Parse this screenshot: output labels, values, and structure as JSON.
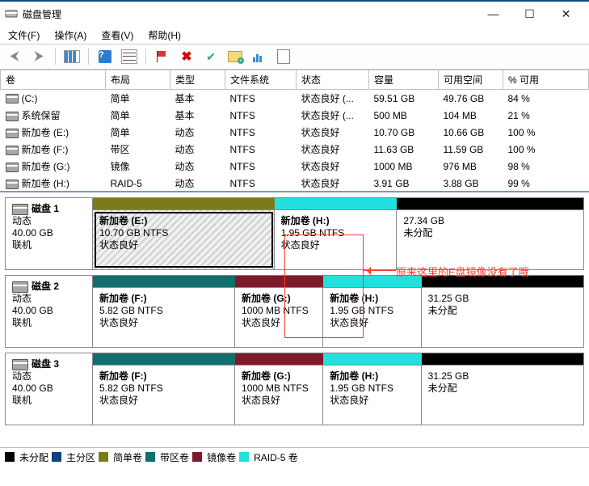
{
  "window": {
    "title": "磁盘管理",
    "min": "—",
    "max": "☐",
    "close": "✕"
  },
  "menu": {
    "file": "文件(F)",
    "action": "操作(A)",
    "view": "查看(V)",
    "help": "帮助(H)"
  },
  "colors": {
    "unallocated": "#000000",
    "primary": "#11427d",
    "simple": "#7b7b1b",
    "striped": "#126e6e",
    "mirror": "#7d1b2a",
    "raid5": "#22e0e0"
  },
  "volumes": {
    "headers": {
      "vol": "卷",
      "layout": "布局",
      "type": "类型",
      "fs": "文件系统",
      "status": "状态",
      "capacity": "容量",
      "free": "可用空间",
      "pct": "% 可用"
    },
    "rows": [
      {
        "name": "(C:)",
        "layout": "简单",
        "type": "基本",
        "fs": "NTFS",
        "status": "状态良好 (...",
        "capacity": "59.51 GB",
        "free": "49.76 GB",
        "pct": "84 %"
      },
      {
        "name": "系统保留",
        "layout": "简单",
        "type": "基本",
        "fs": "NTFS",
        "status": "状态良好 (...",
        "capacity": "500 MB",
        "free": "104 MB",
        "pct": "21 %"
      },
      {
        "name": "新加卷 (E:)",
        "layout": "简单",
        "type": "动态",
        "fs": "NTFS",
        "status": "状态良好",
        "capacity": "10.70 GB",
        "free": "10.66 GB",
        "pct": "100 %"
      },
      {
        "name": "新加卷 (F:)",
        "layout": "带区",
        "type": "动态",
        "fs": "NTFS",
        "status": "状态良好",
        "capacity": "11.63 GB",
        "free": "11.59 GB",
        "pct": "100 %"
      },
      {
        "name": "新加卷 (G:)",
        "layout": "镜像",
        "type": "动态",
        "fs": "NTFS",
        "status": "状态良好",
        "capacity": "1000 MB",
        "free": "976 MB",
        "pct": "98 %"
      },
      {
        "name": "新加卷 (H:)",
        "layout": "RAID-5",
        "type": "动态",
        "fs": "NTFS",
        "status": "状态良好",
        "capacity": "3.91 GB",
        "free": "3.88 GB",
        "pct": "99 %"
      }
    ]
  },
  "disks": [
    {
      "title": "磁盘 1",
      "type": "动态",
      "size": "40.00 GB",
      "state": "联机",
      "partitions": [
        {
          "name": "新加卷  (E:)",
          "detail": "10.70 GB NTFS",
          "status": "状态良好",
          "width": "37%",
          "band_color": "simple",
          "hatched": true
        },
        {
          "name": "新加卷  (H:)",
          "detail": "1.95 GB NTFS",
          "status": "状态良好",
          "width": "25%",
          "band_color": "raid5"
        },
        {
          "name": "",
          "detail": "27.34 GB",
          "status": "未分配",
          "width": "38%",
          "band_color": "unallocated"
        }
      ]
    },
    {
      "title": "磁盘 2",
      "type": "动态",
      "size": "40.00 GB",
      "state": "联机",
      "partitions": [
        {
          "name": "新加卷  (F:)",
          "detail": "5.82 GB NTFS",
          "status": "状态良好",
          "width": "29%",
          "band_color": "striped"
        },
        {
          "name": "新加卷  (G:)",
          "detail": "1000 MB NTFS",
          "status": "状态良好",
          "width": "18%",
          "band_color": "mirror"
        },
        {
          "name": "新加卷  (H:)",
          "detail": "1.95 GB NTFS",
          "status": "状态良好",
          "width": "20%",
          "band_color": "raid5"
        },
        {
          "name": "",
          "detail": "31.25 GB",
          "status": "未分配",
          "width": "33%",
          "band_color": "unallocated"
        }
      ]
    },
    {
      "title": "磁盘 3",
      "type": "动态",
      "size": "40.00 GB",
      "state": "联机",
      "partitions": [
        {
          "name": "新加卷  (F:)",
          "detail": "5.82 GB NTFS",
          "status": "状态良好",
          "width": "29%",
          "band_color": "striped"
        },
        {
          "name": "新加卷  (G:)",
          "detail": "1000 MB NTFS",
          "status": "状态良好",
          "width": "18%",
          "band_color": "mirror"
        },
        {
          "name": "新加卷  (H:)",
          "detail": "1.95 GB NTFS",
          "status": "状态良好",
          "width": "20%",
          "band_color": "raid5"
        },
        {
          "name": "",
          "detail": "31.25 GB",
          "status": "未分配",
          "width": "33%",
          "band_color": "unallocated"
        }
      ]
    }
  ],
  "legend": {
    "unallocated": "未分配",
    "primary": "主分区",
    "simple": "简单卷",
    "striped": "带区卷",
    "mirror": "镜像卷",
    "raid5": "RAID-5 卷"
  },
  "annotation": "原来这里的E盘镜像没有了哦"
}
